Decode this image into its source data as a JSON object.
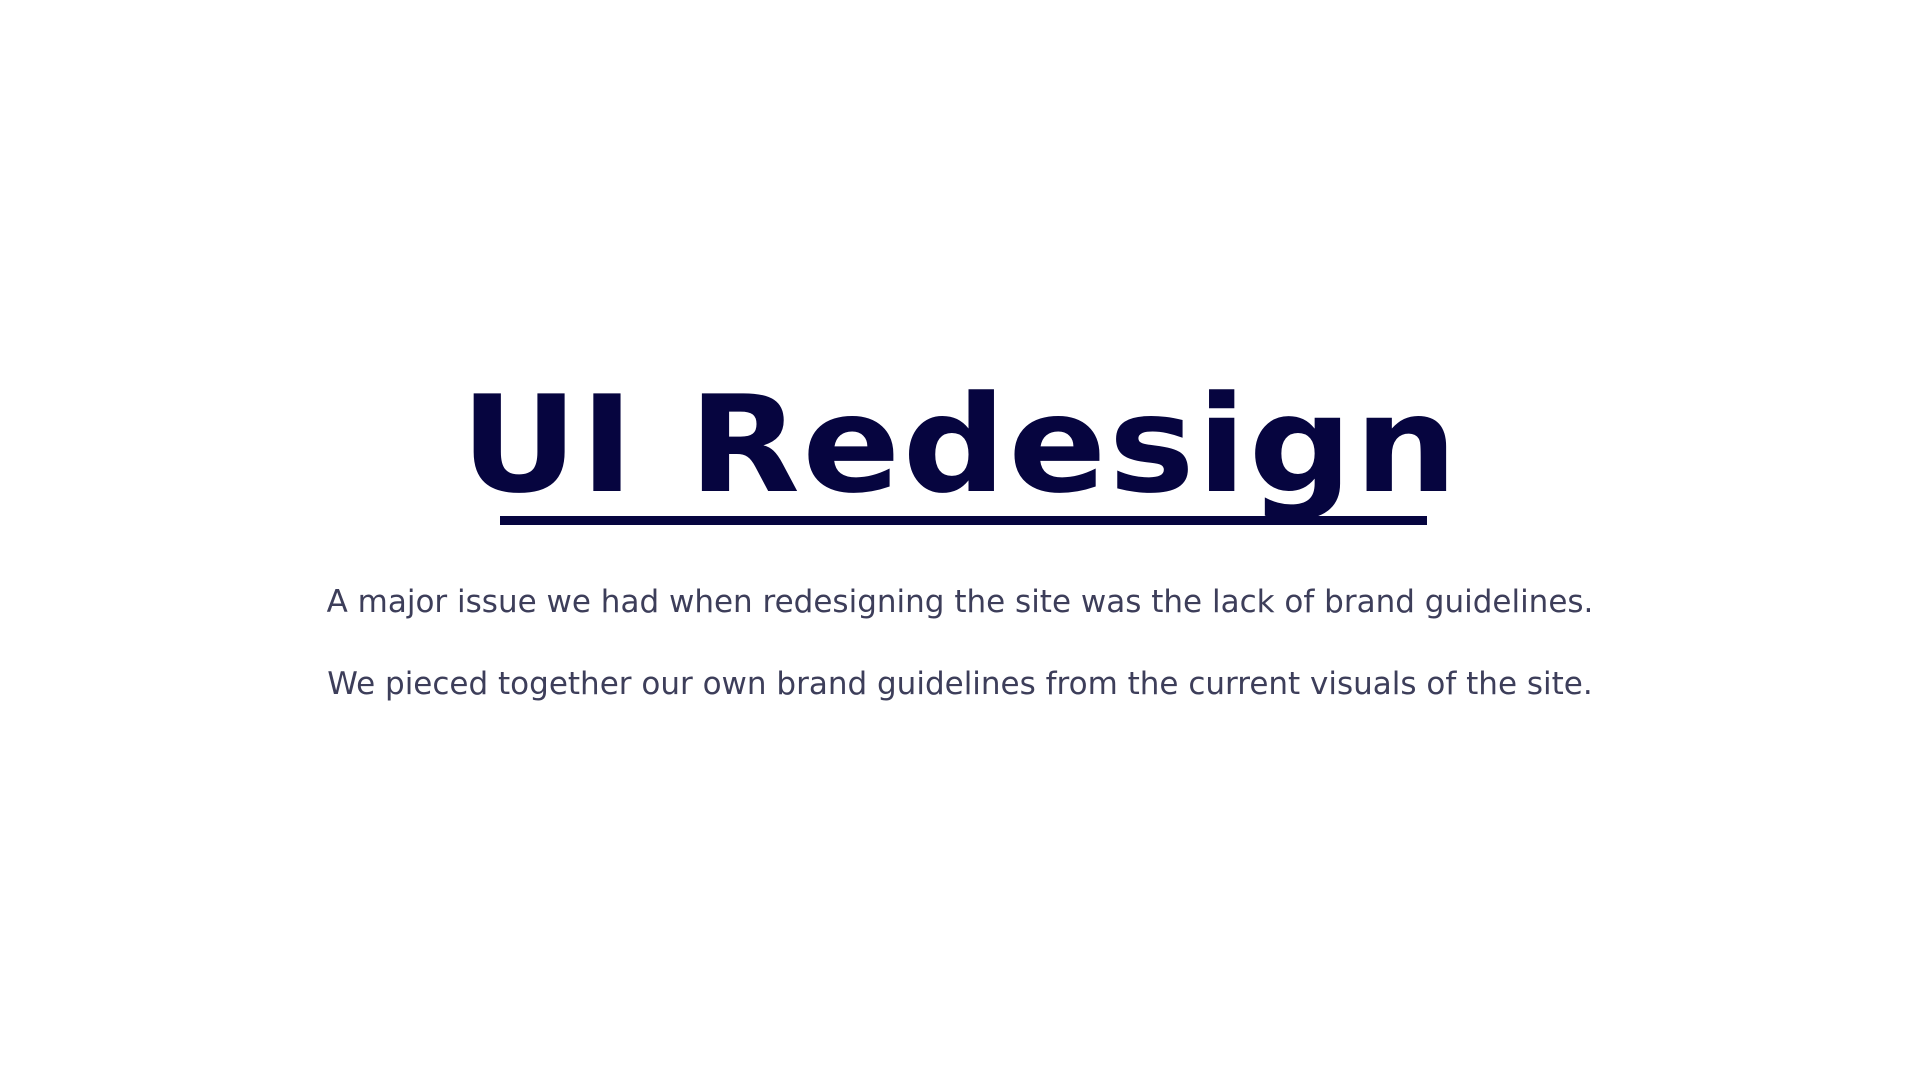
{
  "slide": {
    "title": "UI Redesign",
    "paragraphs": [
      "A major issue we had when redesigning the site was the lack of brand guidelines.",
      "We pieced together our own brand guidelines from the current visuals of the site."
    ]
  },
  "colors": {
    "title": "#06053f",
    "body_text": "#3d3e5a",
    "background": "#ffffff"
  }
}
